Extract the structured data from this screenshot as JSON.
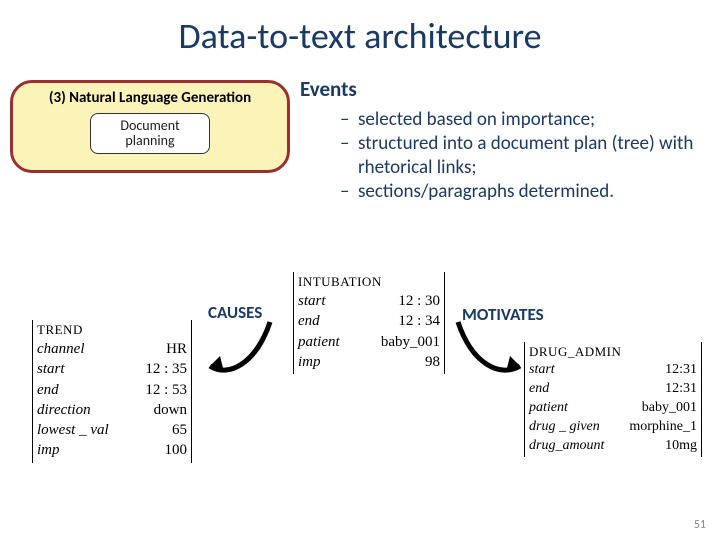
{
  "title": "Data-to-text architecture",
  "panel": {
    "heading": "(3) Natural Language Generation",
    "box": "Document planning"
  },
  "events": {
    "heading": "Events",
    "items": [
      "selected based on importance;",
      "structured into a document plan (tree) with rhetorical links;",
      "sections/paragraphs determined."
    ]
  },
  "relations": {
    "causes": "CAUSES",
    "motivates": "MOTIVATES"
  },
  "tables": {
    "trend": {
      "header": "TREND",
      "rows": [
        [
          "channel",
          "HR"
        ],
        [
          "start",
          "12 : 35"
        ],
        [
          "end",
          "12 : 53"
        ],
        [
          "direction",
          "down"
        ],
        [
          "lowest _ val",
          "65"
        ],
        [
          "imp",
          "100"
        ]
      ]
    },
    "intubation": {
      "header": "INTUBATION",
      "rows": [
        [
          "start",
          "12 : 30"
        ],
        [
          "end",
          "12 : 34"
        ],
        [
          "patient",
          "baby_001"
        ],
        [
          "imp",
          "98"
        ]
      ]
    },
    "drug": {
      "header": "DRUG_ADMIN",
      "rows": [
        [
          "start",
          "12:31"
        ],
        [
          "end",
          "12:31"
        ],
        [
          "patient",
          "baby_001"
        ],
        [
          "drug _ given",
          "morphine_1"
        ],
        [
          "drug_amount",
          "10mg"
        ]
      ]
    }
  },
  "page_number": "51"
}
